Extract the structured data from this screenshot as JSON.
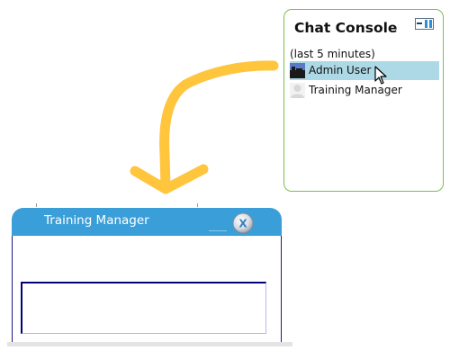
{
  "chat_console": {
    "title": "Chat Console",
    "subtitle": "(last 5 minutes)",
    "dock_toggle_icon": "dock-toggle-icon",
    "users": [
      {
        "name": "Admin User",
        "avatar_icon": "admin-user-avatar-icon",
        "selected": true
      },
      {
        "name": "Training Manager",
        "avatar_icon": "default-user-avatar-icon",
        "selected": false
      }
    ],
    "colors": {
      "border": "#7cc04e",
      "selected_row": "#add8e6"
    }
  },
  "annotation": {
    "arrow_icon": "hand-drawn-arrow-icon",
    "color": "#ffc53d"
  },
  "chat_window": {
    "title": "Training Manager",
    "close_label": "X",
    "minimize_icon": "minimize-icon",
    "colors": {
      "header": "#3a9fd8",
      "border": "#1a1a8c"
    }
  }
}
